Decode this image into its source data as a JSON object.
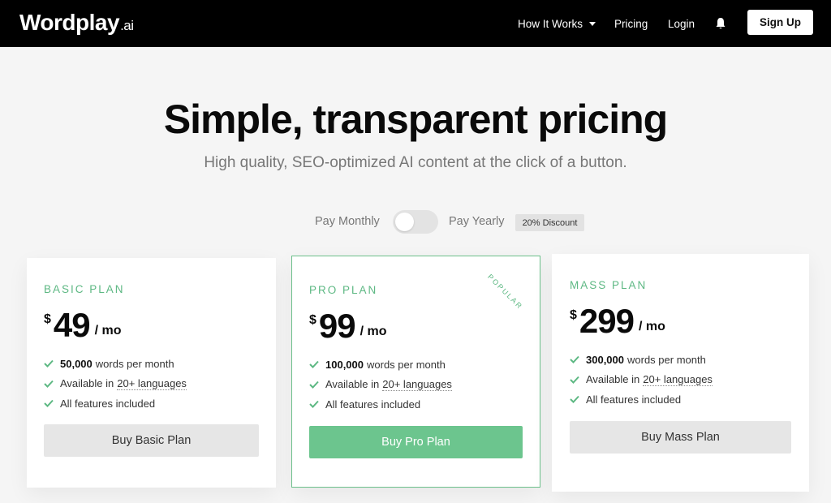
{
  "header": {
    "logo_main": "Wordplay",
    "logo_suffix": ".ai",
    "nav": {
      "how": "How It Works",
      "pricing": "Pricing",
      "login": "Login"
    },
    "signup": "Sign Up"
  },
  "hero": {
    "title": "Simple, transparent pricing",
    "subtitle": "High quality, SEO-optimized AI content at the click of a button."
  },
  "billing": {
    "monthly": "Pay Monthly",
    "yearly": "Pay Yearly",
    "discount": "20% Discount",
    "toggle_on": false
  },
  "plans": [
    {
      "name": "BASIC PLAN",
      "currency": "$",
      "price": "49",
      "period": "/ mo",
      "words_bold": "50,000",
      "words_rest": "words per month",
      "lang_prefix": "Available in",
      "lang_link": "20+ languages",
      "features_all": "All features included",
      "button": "Buy Basic Plan"
    },
    {
      "name": "PRO PLAN",
      "currency": "$",
      "price": "99",
      "period": "/ mo",
      "words_bold": "100,000",
      "words_rest": "words per month",
      "lang_prefix": "Available in",
      "lang_link": "20+ languages",
      "features_all": "All features included",
      "button": "Buy Pro Plan",
      "ribbon": "POPULAR"
    },
    {
      "name": "MASS PLAN",
      "currency": "$",
      "price": "299",
      "period": "/ mo",
      "words_bold": "300,000",
      "words_rest": "words per month",
      "lang_prefix": "Available in",
      "lang_link": "20+ languages",
      "features_all": "All features included",
      "button": "Buy Mass Plan"
    }
  ],
  "colors": {
    "accent": "#5db883",
    "button_green": "#6cc58e",
    "header_bg": "#000000"
  },
  "icons": {
    "bell": "bell-icon",
    "check": "check-icon",
    "caret": "chevron-down-icon"
  }
}
